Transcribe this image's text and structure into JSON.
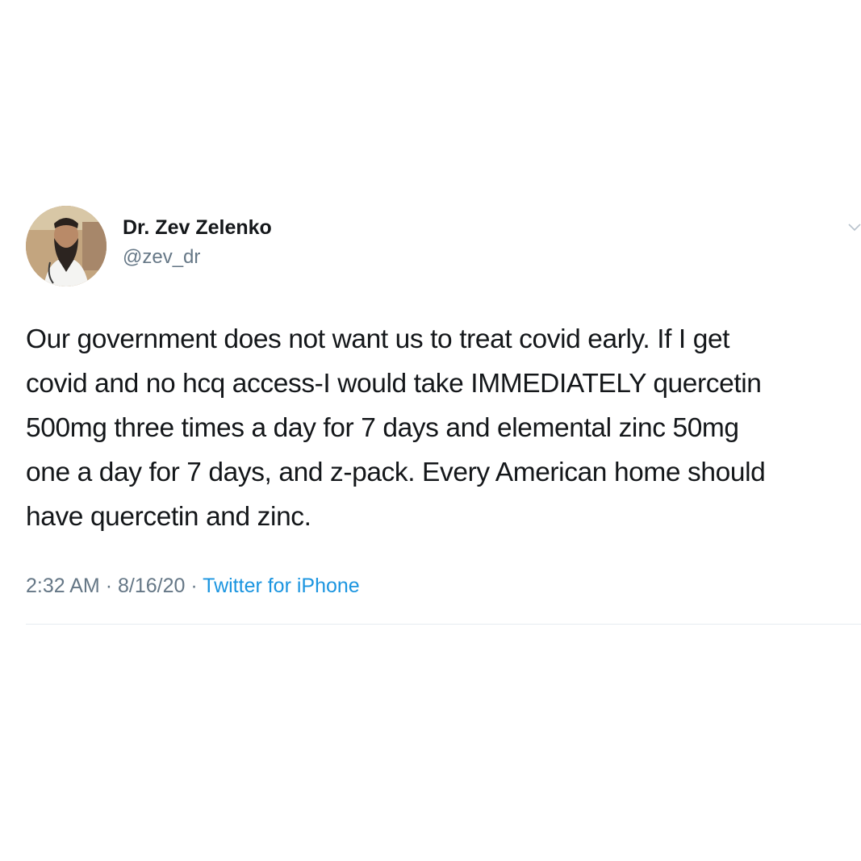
{
  "tweet": {
    "author": {
      "name": "Dr. Zev Zelenko",
      "handle": "@zev_dr"
    },
    "text": "Our government does not want us to treat covid early. If I get\ncovid and no hcq access-I would take IMMEDIATELY quercetin\n500mg three times a day for 7 days and elemental zinc 50mg\none a day for 7 days, and z-pack. Every American home should\nhave quercetin and zinc.",
    "time": "2:32 AM",
    "separator": "·",
    "date": "8/16/20",
    "source": "Twitter for iPhone"
  },
  "colors": {
    "text": "#14171a",
    "secondary": "#657786",
    "link": "#1b95e0",
    "divider": "#e6ecf0"
  },
  "icons": {
    "menu": "chevron-down-icon",
    "avatar": "profile-photo"
  }
}
